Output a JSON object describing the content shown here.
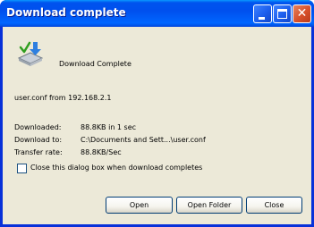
{
  "window": {
    "title": "Download complete",
    "title_buttons": [
      "minimize",
      "maximize",
      "close"
    ]
  },
  "header": {
    "icon": "download-complete-icon",
    "label": "Download Complete"
  },
  "source_line": "user.conf from 192.168.2.1",
  "details": [
    {
      "label": "Downloaded:",
      "value": "88.8KB in 1 sec"
    },
    {
      "label": "Download to:",
      "value": "C:\\Documents and Sett...\\user.conf"
    },
    {
      "label": "Transfer rate:",
      "value": "88.8KB/Sec"
    }
  ],
  "close_checkbox": {
    "label": "Close this dialog box when download completes",
    "checked": false
  },
  "buttons": {
    "open": "Open",
    "open_folder": "Open Folder",
    "close": "Close"
  },
  "colors": {
    "titlebar": "#0058ee",
    "client_bg": "#ece9d8",
    "close_button": "#d7502a"
  }
}
